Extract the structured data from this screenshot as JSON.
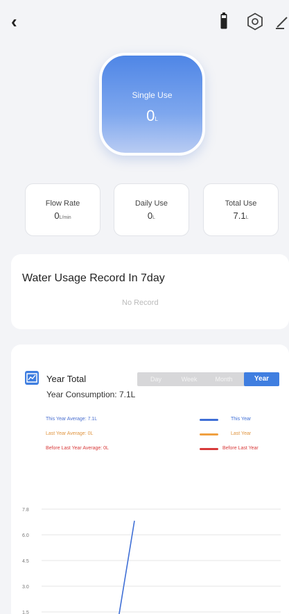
{
  "header": {
    "back_icon": "chevron-left-icon",
    "right_icons": [
      "battery-icon",
      "settings-icon",
      "edit-icon"
    ]
  },
  "hero": {
    "label": "Single Use",
    "value": "0",
    "unit": "L",
    "gradient_top": "#4f86e6",
    "gradient_bottom": "#b9ccf3"
  },
  "stats": [
    {
      "label": "Flow Rate",
      "value": "0",
      "unit": "L/min"
    },
    {
      "label": "Daily Use",
      "value": "0",
      "unit": "L"
    },
    {
      "label": "Total Use",
      "value": "7.1",
      "unit": "L"
    }
  ],
  "record_card": {
    "title": "Water Usage Record In 7day",
    "empty_text": "No Record"
  },
  "year_card": {
    "title": "Year Total",
    "tabs": [
      "Day",
      "Week",
      "Month",
      "Year"
    ],
    "active_tab": "Year",
    "consumption": "Year Consumption: 7.1L",
    "averages": [
      {
        "text": "This Year Average: 7.1L",
        "color": "#4a6fd0"
      },
      {
        "text": "Last Year Average: 0L",
        "color": "#e09540"
      },
      {
        "text": "Before Last Year Average: 0L",
        "color": "#d83a3a"
      }
    ],
    "legend": [
      {
        "label": "This Year",
        "color": "#3f6fd6"
      },
      {
        "label": "Last Year",
        "color": "#f0a040"
      },
      {
        "label": "Before Last Year",
        "color": "#d83a3a"
      }
    ]
  },
  "chart_data": {
    "type": "line",
    "title": "",
    "xlabel": "",
    "ylabel": "",
    "y_ticks": [
      "7.8",
      "6.0",
      "4.5",
      "3.0",
      "1.5"
    ],
    "ylim": [
      0,
      7.8
    ],
    "grid": true,
    "series": [
      {
        "name": "This Year",
        "color": "#3f6fd6",
        "x": [
          1,
          2
        ],
        "y": [
          0,
          7.1
        ]
      }
    ],
    "x_range": [
      1,
      12
    ]
  },
  "accent_color": "#3f7ee0"
}
